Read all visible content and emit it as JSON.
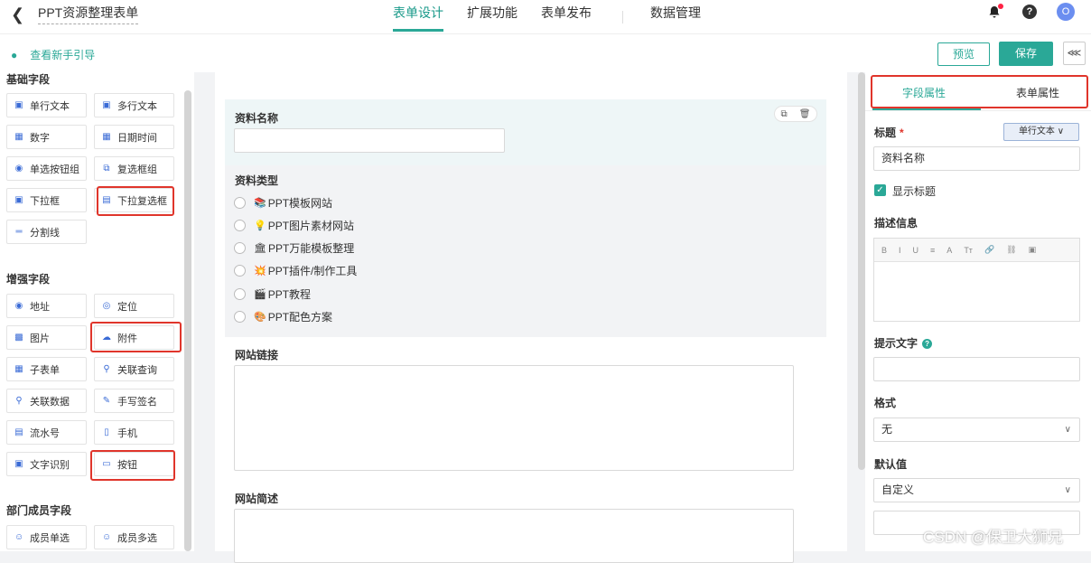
{
  "header": {
    "back_icon": "chevron-left-icon",
    "app_title": "PPT资源整理表单",
    "tabs": [
      {
        "label": "表单设计",
        "active": true
      },
      {
        "label": "扩展功能",
        "active": false
      },
      {
        "label": "表单发布",
        "active": false
      },
      {
        "label": "数据管理",
        "active": false
      }
    ],
    "avatar_letter": "O",
    "accent_color": "#2aa897"
  },
  "toolbar": {
    "guide_label": "查看新手引导",
    "preview_label": "预览",
    "save_label": "保存"
  },
  "left_panel": {
    "sections": [
      {
        "title": "基础字段",
        "items": [
          "单行文本",
          "多行文本",
          "数字",
          "日期时间",
          "单选按钮组",
          "复选框组",
          "下拉框",
          "下拉复选框",
          "分割线"
        ]
      },
      {
        "title": "增强字段",
        "items": [
          "地址",
          "定位",
          "图片",
          "附件",
          "子表单",
          "关联查询",
          "关联数据",
          "手写签名",
          "流水号",
          "手机",
          "文字识别",
          "按钮"
        ]
      },
      {
        "title": "部门成员字段",
        "items": [
          "成员单选",
          "成员多选"
        ]
      }
    ]
  },
  "canvas": {
    "fields": {
      "name_label": "资料名称",
      "type_label": "资料类型",
      "options": [
        {
          "emoji": "📚",
          "text": "PPT模板网站"
        },
        {
          "emoji": "💡",
          "text": "PPT图片素材网站"
        },
        {
          "emoji": "🏛",
          "text": "PPT万能模板整理"
        },
        {
          "emoji": "💥",
          "text": "PPT插件/制作工具"
        },
        {
          "emoji": "🎬",
          "text": "PPT教程"
        },
        {
          "emoji": "🎨",
          "text": "PPT配色方案"
        }
      ],
      "link_label": "网站链接",
      "desc_label": "网站简述"
    }
  },
  "right_panel": {
    "tab_field": "字段属性",
    "tab_form": "表单属性",
    "title_label": "标题",
    "required_mark": "*",
    "type_button": "单行文本 ∨",
    "title_value": "资料名称",
    "show_title_label": "显示标题",
    "desc_label": "描述信息",
    "editor_tools": [
      "B",
      "I",
      "U",
      "≡",
      "A",
      "Tт",
      "🔗",
      "⛓",
      "▣"
    ],
    "hint_label": "提示文字",
    "format_label": "格式",
    "format_value": "无",
    "default_label": "默认值",
    "default_value": "自定义"
  },
  "watermark": "CSDN @保卫大狮兄"
}
